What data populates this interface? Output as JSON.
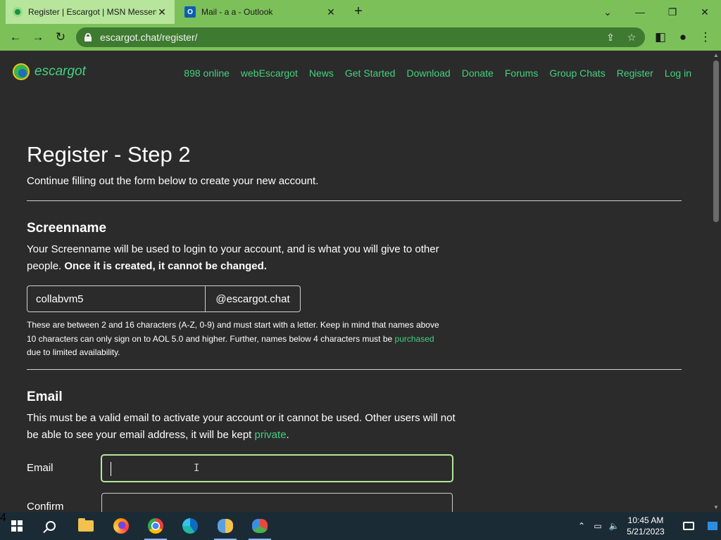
{
  "browser": {
    "tabs": [
      {
        "title": "Register | Escargot | MSN Messenger",
        "icon": "escargot-favicon"
      },
      {
        "title": "Mail - a a - Outlook",
        "icon": "outlook-favicon"
      }
    ],
    "new_tab": "+",
    "url": "escargot.chat/register/",
    "window_controls": {
      "down": "⌄",
      "minimize": "—",
      "restore": "❐",
      "close": "✕"
    },
    "tab_close": "✕"
  },
  "site": {
    "brand": "escargot",
    "nav": [
      "898 online",
      "webEscargot",
      "News",
      "Get Started",
      "Download",
      "Donate",
      "Forums",
      "Group Chats",
      "Register",
      "Log in"
    ]
  },
  "form": {
    "title": "Register - Step 2",
    "lead": "Continue filling out the form below to create your new account.",
    "screenname": {
      "heading": "Screenname",
      "desc": "Your Screenname will be used to login to your account, and is what you will give to other people.",
      "desc_bold": "Once it is created, it cannot be changed.",
      "value": "collabvm5",
      "suffix": "@escargot.chat",
      "note_1": "These are between 2 and 16 characters (A-Z, 0-9) and must start with a letter. Keep in mind that names above 10 characters can only sign on to AOL 5.0 and higher. Further, names below 4 characters must be ",
      "note_link": "purchased",
      "note_2": " due to limited availability."
    },
    "email": {
      "heading": "Email",
      "desc": "This must be a valid email to activate your account or it cannot be used. Other users will not be able to see your email address, it will be kept ",
      "desc_link": "private",
      "desc_end": ".",
      "email_label": "Email",
      "email_value": "",
      "confirm_label": "Confirm",
      "confirm_value": ""
    }
  },
  "taskbar": {
    "time": "10:45 AM",
    "date": "5/21/2023",
    "notifications": "4",
    "tray_chevron": "⌃"
  },
  "colors": {
    "accent_green": "#44d17f",
    "browser_frame": "#7cc05a",
    "page_bg": "#2b2b2b",
    "taskbar_bg": "#1b2b36"
  }
}
